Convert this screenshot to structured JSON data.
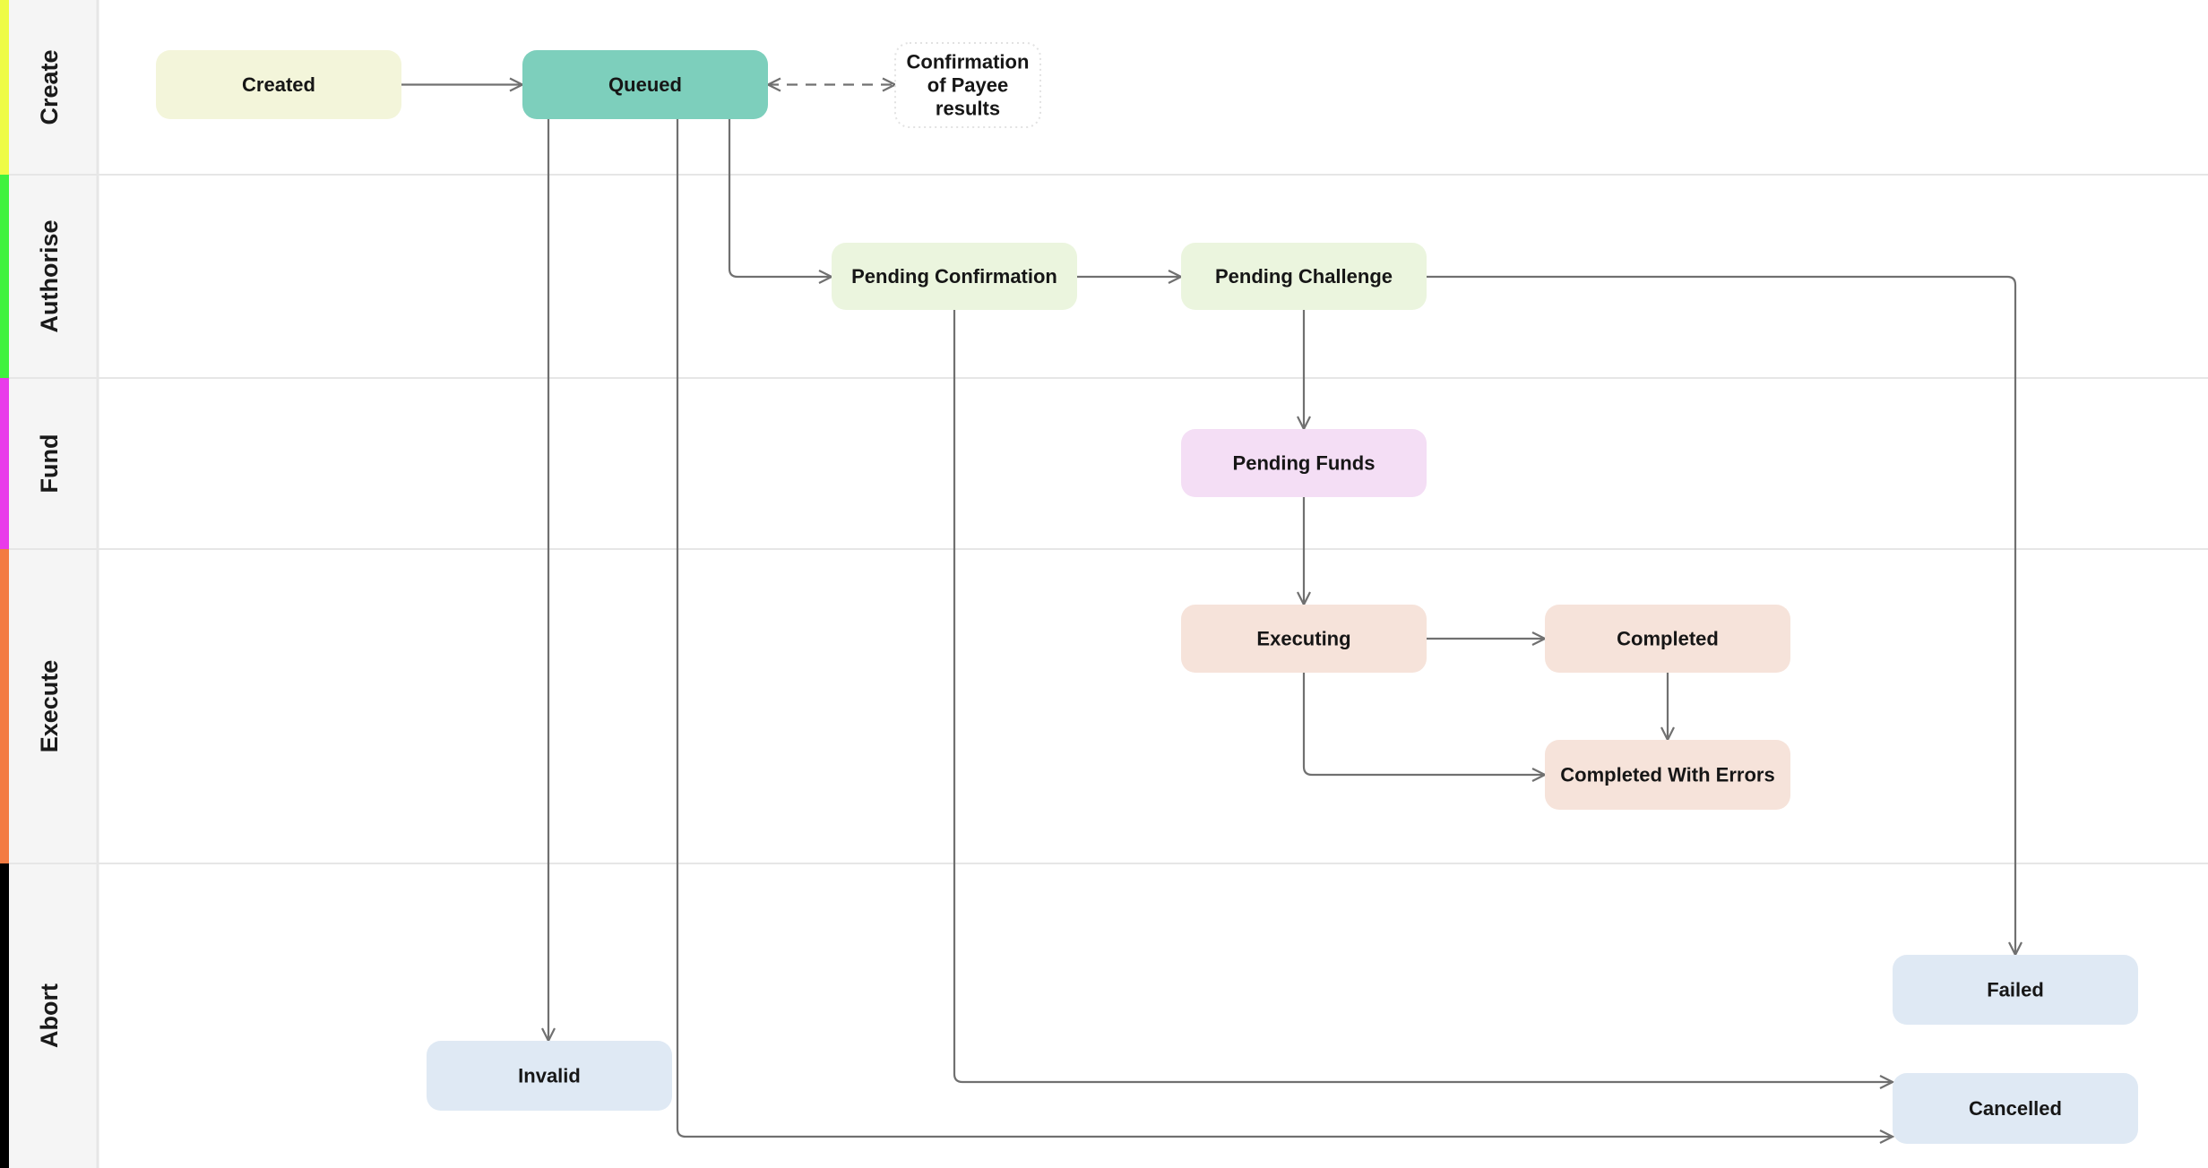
{
  "diagram": {
    "lanes": [
      {
        "id": "create",
        "label": "Create",
        "color": "#eefb45"
      },
      {
        "id": "authorise",
        "label": "Authorise",
        "color": "#3ff23e"
      },
      {
        "id": "fund",
        "label": "Fund",
        "color": "#e93bea"
      },
      {
        "id": "execute",
        "label": "Execute",
        "color": "#f37b42"
      },
      {
        "id": "abort",
        "label": "Abort",
        "color": "#000000"
      }
    ],
    "nodes": [
      {
        "id": "created",
        "label": "Created",
        "lane": "create",
        "fill": "#f3f5da"
      },
      {
        "id": "queued",
        "label": "Queued",
        "lane": "create",
        "fill": "#7dcfbc"
      },
      {
        "id": "cop",
        "label": "Confirmation of Payee results",
        "lines": [
          "Confirmation",
          "of Payee",
          "results"
        ],
        "lane": "create",
        "fill": "#ffffff",
        "style": "dotted"
      },
      {
        "id": "pending_confirmation",
        "label": "Pending Confirmation",
        "lane": "authorise",
        "fill": "#ebf5de"
      },
      {
        "id": "pending_challenge",
        "label": "Pending Challenge",
        "lane": "authorise",
        "fill": "#ebf5de"
      },
      {
        "id": "pending_funds",
        "label": "Pending Funds",
        "lane": "fund",
        "fill": "#f4def5"
      },
      {
        "id": "executing",
        "label": "Executing",
        "lane": "execute",
        "fill": "#f6e3da"
      },
      {
        "id": "completed",
        "label": "Completed",
        "lane": "execute",
        "fill": "#f6e3da"
      },
      {
        "id": "completed_with_errors",
        "label": "Completed With Errors",
        "lane": "execute",
        "fill": "#f6e3da"
      },
      {
        "id": "failed",
        "label": "Failed",
        "lane": "abort",
        "fill": "#dfe9f4"
      },
      {
        "id": "invalid",
        "label": "Invalid",
        "lane": "abort",
        "fill": "#dfe9f4"
      },
      {
        "id": "cancelled",
        "label": "Cancelled",
        "lane": "abort",
        "fill": "#dfe9f4"
      }
    ],
    "edges": [
      {
        "from": "created",
        "to": "queued"
      },
      {
        "from": "queued",
        "to": "cop",
        "style": "dashed",
        "bidirectional": true
      },
      {
        "from": "queued",
        "to": "pending_confirmation"
      },
      {
        "from": "queued",
        "to": "invalid"
      },
      {
        "from": "queued",
        "to": "cancelled"
      },
      {
        "from": "pending_confirmation",
        "to": "pending_challenge"
      },
      {
        "from": "pending_confirmation",
        "to": "cancelled"
      },
      {
        "from": "pending_challenge",
        "to": "pending_funds"
      },
      {
        "from": "pending_challenge",
        "to": "failed"
      },
      {
        "from": "pending_funds",
        "to": "executing"
      },
      {
        "from": "executing",
        "to": "completed"
      },
      {
        "from": "executing",
        "to": "completed_with_errors"
      },
      {
        "from": "completed",
        "to": "completed_with_errors"
      }
    ]
  }
}
